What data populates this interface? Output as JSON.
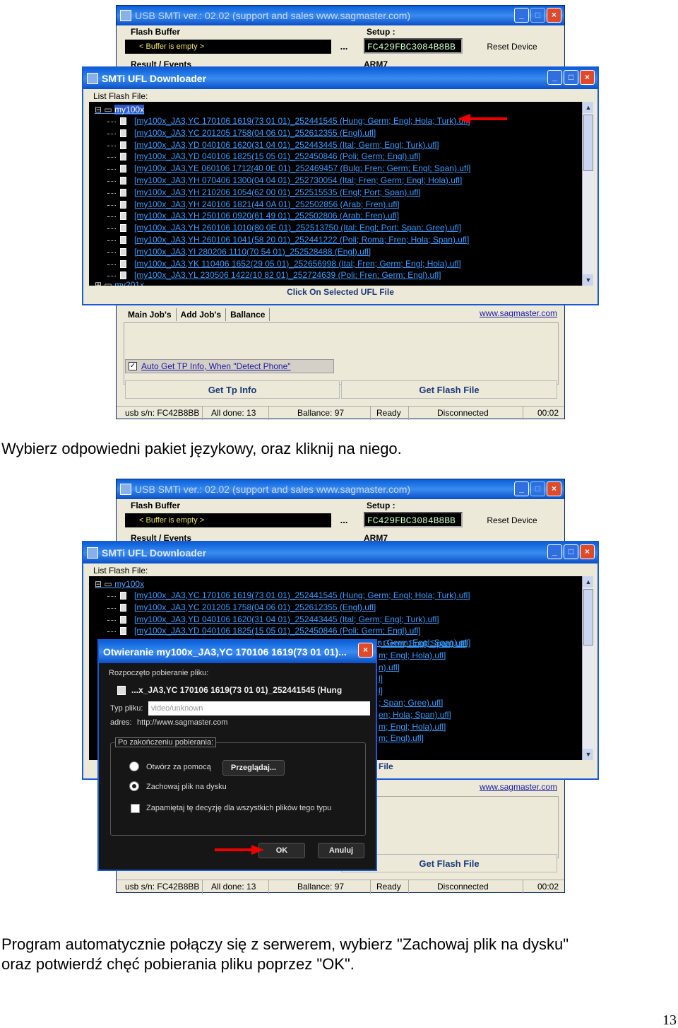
{
  "app": {
    "title": "USB SMTi  ver.: 02.02 (support and sales www.sagmaster.com)",
    "flash_buffer_label": "Flash Buffer",
    "buffer_value": "< Buffer is empty >",
    "dots_button": "...",
    "setup_label": "Setup :",
    "setup_value": "FC429FBC3084B8BB",
    "reset_button": "Reset Device",
    "result_label": "Result / Events",
    "arm_label": "ARM7",
    "tabs": [
      "Main Job's",
      "Add Job's",
      "Ballance"
    ],
    "site_link": "www.sagmaster.com",
    "auto_get_label": "Auto Get TP Info, When \"Detect Phone\"",
    "get_tp_button": "Get Tp Info",
    "get_flash_button": "Get Flash File",
    "status": {
      "serial": "usb s/n: FC42B8BB",
      "all_done": "All done: 13",
      "ballance": "Ballance: 97",
      "ready": "Ready",
      "connection": "Disconnected",
      "time": "00:02"
    }
  },
  "downloader": {
    "title": "SMTi UFL Downloader",
    "list_label": "List Flash File:",
    "root_folder": "my100x",
    "next_folder": "my201x",
    "files": [
      "[my100x_JA3,YC 170106 1619(73 01 01)_252441545 (Hung; Germ; Engl; Hola; Turk).ufl]",
      "[my100x_JA3,YC 201205 1758(04 06 01)_252612355 (Engl).ufl]",
      "[my100x_JA3,YD 040106 1620(31 04 01)_252443445 (Ital; Germ; Engl; Turk).ufl]",
      "[my100x_JA3,YD 040106 1825(15 05 01)_252450846 (Poli; Germ; Engl).ufl]",
      "[my100x_JA3,YE 060106 1712(40 0E 01)_252469457 (Bulg; Fren; Germ; Engl; Span).ufl]",
      "[my100x_JA3,YH 070406 1300(04 04 01)_252730054 (Ital; Fren; Germ; Engl; Hola).ufl]",
      "[my100x_JA3,YH 210206 1054(62 00 01)_252515535 (Engl; Port; Span).ufl]",
      "[my100x_JA3,YH 240106 1821(44 0A 01)_252502856 (Arab; Fren).ufl]",
      "[my100x_JA3,YH 250106 0920(61 49 01)_252502806 (Arab; Fren).ufl]",
      "[my100x_JA3,YH 260106 1010(80 0E 01)_252513750 (Ital; Engl; Port; Span; Gree).ufl]",
      "[my100x_JA3,YH 260106 1041(58 20 01)_252441222 (Poli; Roma; Fren; Hola; Span).ufl]",
      "[my100x_JA3,YI 280206 1110(70 54 01)_252528488 (Engl).ufl]",
      "[my100x_JA3,YK 110406 1652(29 05 01)_252656998 (Ital; Fren; Germ; Engl; Hola).ufl]",
      "[my100x_JA3,YL 230506 1422(10 82 01)_252724639 (Poli; Fren; Germ; Engl).ufl]"
    ],
    "click_label": "Click On Selected UFL File",
    "partial_click_label": "File",
    "partial_files": [
      "; Germ; Engl; Span).ufl]",
      "m; Engl; Hola).ufl]",
      "n).ufl]",
      "l]",
      "l]",
      "; Span; Gree).ufl]",
      "en; Hola; Span).ufl]",
      "m; Engl; Hola).ufl]",
      "m; Engl).ufl]"
    ]
  },
  "dialog": {
    "title": "Otwieranie my100x_JA3,YC 170106 1619(73 01 01)...",
    "started": "Rozpoczęto pobieranie pliku:",
    "filename": "...x_JA3,YC 170106 1619(73 01 01)_252441545 (Hung",
    "type_label": "Typ pliku:",
    "type_value": "video/unknown",
    "address_label": "adres:",
    "address_value": "http://www.sagmaster.com",
    "after_label": "Po zakończeniu pobierania:",
    "open_with": "Otwórz za pomocą",
    "browse_button": "Przeglądaj...",
    "save_file": "Zachowaj plik na dysku",
    "remember": "Zapamiętaj tę decyzję dla wszystkich plików tego typu",
    "ok_button": "OK",
    "cancel_button": "Anuluj"
  },
  "captions": {
    "first": "Wybierz odpowiedni pakiet językowy, oraz kliknij na niego.",
    "second_line1": "Program automatycznie połączy się z serwerem, wybierz \"Zachowaj plik na dysku\"",
    "second_line2": "oraz potwierdź chęć pobierania pliku poprzez \"OK\"."
  },
  "page_number": "13",
  "colors": {
    "arrow": "#ee0000",
    "titlebar": "#0a5fd8",
    "link": "#3a9cff"
  }
}
